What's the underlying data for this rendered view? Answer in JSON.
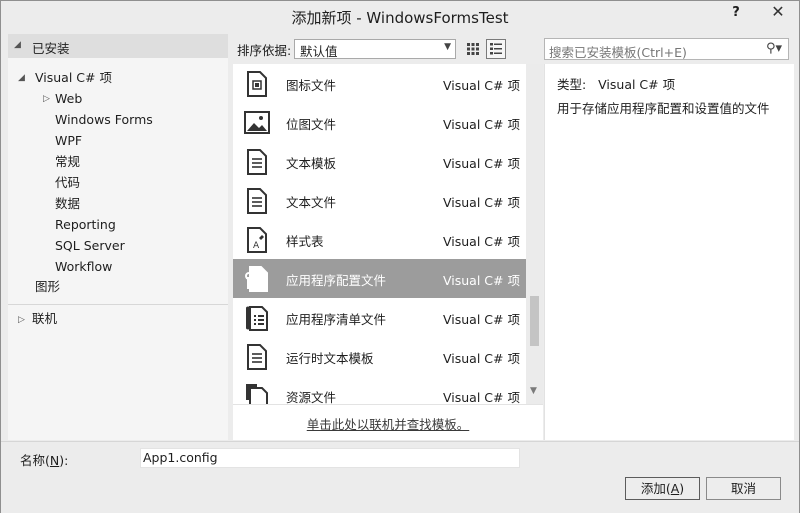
{
  "window": {
    "title": "添加新项 - WindowsFormsTest",
    "help": "?",
    "close": "✕"
  },
  "left": {
    "installed": "已安装",
    "tree": [
      "Visual C# 项",
      "Web",
      "Windows Forms",
      "WPF",
      "常规",
      "代码",
      "数据",
      "Reporting",
      "SQL Server",
      "Workflow",
      "图形"
    ],
    "online": "联机"
  },
  "toolbar": {
    "sort_label": "排序依据:",
    "sort_value": "默认值",
    "search_placeholder": "搜索已安装模板(Ctrl+E)"
  },
  "templates": [
    {
      "name": "图标文件",
      "kind": "Visual C# 项",
      "icon": "icon-file-icon"
    },
    {
      "name": "位图文件",
      "kind": "Visual C# 项",
      "icon": "bitmap-icon"
    },
    {
      "name": "文本模板",
      "kind": "Visual C# 项",
      "icon": "text-template-icon"
    },
    {
      "name": "文本文件",
      "kind": "Visual C# 项",
      "icon": "text-file-icon"
    },
    {
      "name": "样式表",
      "kind": "Visual C# 项",
      "icon": "stylesheet-icon"
    },
    {
      "name": "应用程序配置文件",
      "kind": "Visual C# 项",
      "icon": "config-file-icon"
    },
    {
      "name": "应用程序清单文件",
      "kind": "Visual C# 项",
      "icon": "manifest-file-icon"
    },
    {
      "name": "运行时文本模板",
      "kind": "Visual C# 项",
      "icon": "runtime-template-icon"
    },
    {
      "name": "资源文件",
      "kind": "Visual C# 项",
      "icon": "resource-file-icon"
    }
  ],
  "selected_index": 5,
  "online_link": "单击此处以联机并查找模板。",
  "detail": {
    "type_label": "类型:",
    "type_value": "Visual C# 项",
    "description": "用于存储应用程序配置和设置值的文件"
  },
  "bottom": {
    "name_label": "名称(N):",
    "name_value": "App1.config",
    "add": "添加(A)",
    "cancel": "取消"
  }
}
